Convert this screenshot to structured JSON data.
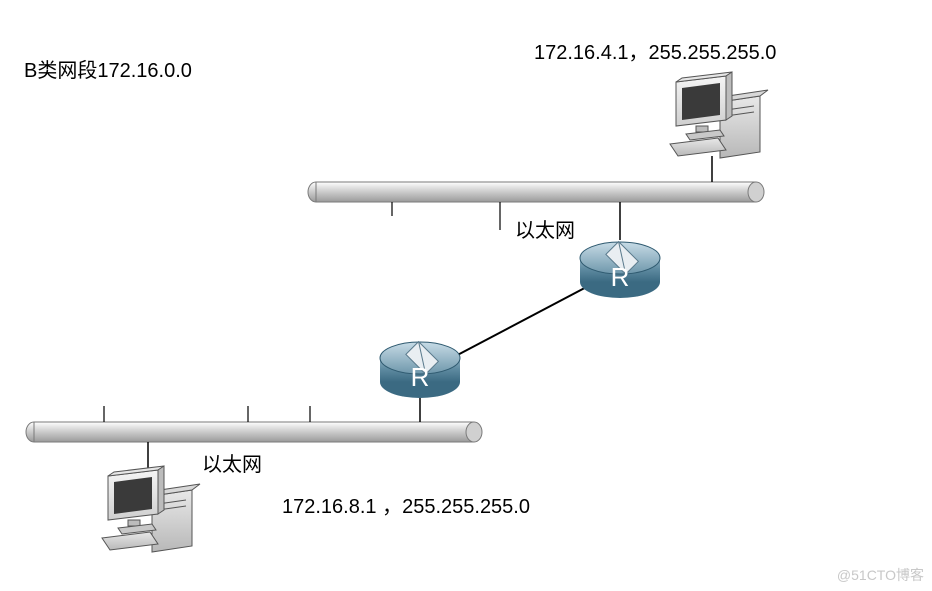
{
  "labels": {
    "class_b_segment": "B类网段172.16.0.0",
    "top_ip": "172.16.4.1，255.255.255.0",
    "bottom_ip": "172.16.8.1 ，255.255.255.0",
    "top_eth": "以太网",
    "bottom_eth": "以太网",
    "router_r_top": "R",
    "router_r_bottom": "R",
    "watermark": "@51CTO博客"
  },
  "diagram": {
    "description": "Two Ethernet segments joined by two routers (R–R link). Top segment has a PC at 172.16.4.1/24; bottom segment has a PC at 172.16.8.1/24. Both are subnets of Class B network 172.16.0.0.",
    "network_class": "B",
    "parent_network": "172.16.0.0",
    "segments": [
      {
        "name": "以太网",
        "host_ip": "172.16.4.1",
        "subnet_mask": "255.255.255.0"
      },
      {
        "name": "以太网",
        "host_ip": "172.16.8.1",
        "subnet_mask": "255.255.255.0"
      }
    ],
    "routers": [
      "R",
      "R"
    ],
    "links": [
      {
        "from": "PC-top",
        "to": "Ethernet-top"
      },
      {
        "from": "Ethernet-top",
        "to": "Router-top"
      },
      {
        "from": "Router-top",
        "to": "Router-bottom"
      },
      {
        "from": "Router-bottom",
        "to": "Ethernet-bottom"
      },
      {
        "from": "Ethernet-bottom",
        "to": "PC-bottom"
      }
    ]
  }
}
